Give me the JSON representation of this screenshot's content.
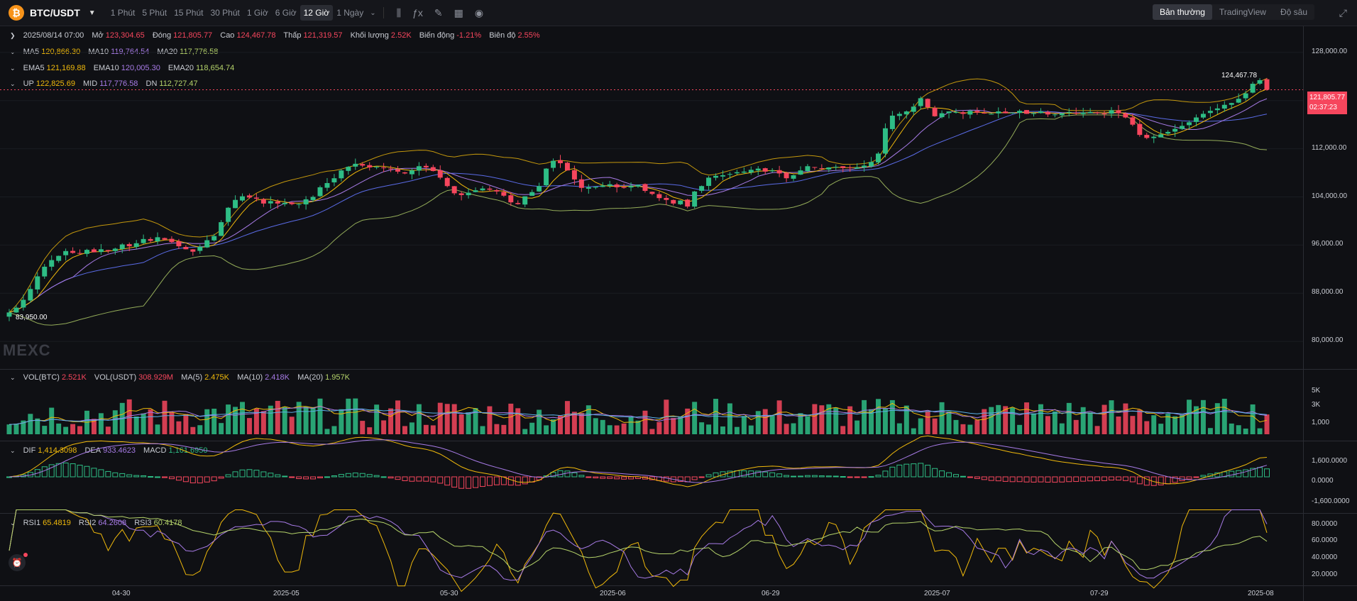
{
  "toolbar": {
    "pair": "BTC/USDT",
    "timeframes": [
      "1 Phút",
      "5 Phút",
      "15 Phút",
      "30 Phút",
      "1 Giờ",
      "6 Giờ",
      "12 Giờ",
      "1 Ngày"
    ],
    "active_timeframe": "12 Giờ",
    "view_tabs": [
      "Bản thường",
      "TradingView",
      "Độ sâu"
    ],
    "active_view": "Bản thường"
  },
  "ohlc": {
    "date": "2025/08/14 07:00",
    "open_label": "Mở",
    "open": "123,304.65",
    "close_label": "Đóng",
    "close": "121,805.77",
    "high_label": "Cao",
    "high": "124,467.78",
    "low_label": "Thấp",
    "low": "121,319.57",
    "volume_label": "Khối lượng",
    "volume": "2.52K",
    "change_label": "Biến động",
    "change": "-1.21%",
    "amplitude_label": "Biên độ",
    "amplitude": "2.55%"
  },
  "ma": {
    "ma5_label": "MA5",
    "ma5": "120,866.30",
    "ma10_label": "MA10",
    "ma10": "119,764.54",
    "ma20_label": "MA20",
    "ma20": "117,776.58"
  },
  "ema": {
    "ema5_label": "EMA5",
    "ema5": "121,169.88",
    "ema10_label": "EMA10",
    "ema10": "120,005.30",
    "ema20_label": "EMA20",
    "ema20": "118,654.74"
  },
  "boll": {
    "up_label": "UP",
    "up": "122,825.69",
    "mid_label": "MID",
    "mid": "117,776.58",
    "dn_label": "DN",
    "dn": "112,727.47"
  },
  "vol": {
    "btc_label": "VOL(BTC)",
    "btc": "2.521K",
    "usdt_label": "VOL(USDT)",
    "usdt": "308.929M",
    "ma5_label": "MA(5)",
    "ma5": "2.475K",
    "ma10_label": "MA(10)",
    "ma10": "2.418K",
    "ma20_label": "MA(20)",
    "ma20": "1.957K"
  },
  "macd": {
    "dif_label": "DIF",
    "dif": "1,414.3098",
    "dea_label": "DEA",
    "dea": "933.4623",
    "macd_label": "MACD",
    "macd": "1,161.6950"
  },
  "rsi": {
    "rsi1_label": "RSI1",
    "rsi1": "65.4819",
    "rsi2_label": "RSI2",
    "rsi2": "64.2608",
    "rsi3_label": "RSI3",
    "rsi3": "60.4178"
  },
  "price_axis": [
    "128,000.00",
    "120,000.00",
    "112,000.00",
    "104,000.00",
    "96,000.00",
    "88,000.00",
    "80,000.00"
  ],
  "vol_axis": [
    "5K",
    "3K",
    "1,000"
  ],
  "macd_axis": [
    "1,600.0000",
    "0.0000",
    "-1,600.0000"
  ],
  "rsi_axis": [
    "80.0000",
    "60.0000",
    "40.0000",
    "20.0000"
  ],
  "x_axis": [
    "04-30",
    "2025-05",
    "05-30",
    "2025-06",
    "06-29",
    "2025-07",
    "07-29",
    "2025-08"
  ],
  "last_price": "121,805.77",
  "countdown": "02:37:23",
  "high_marker": "124,467.78",
  "low_marker": "83,950.00",
  "watermark": "MEXC",
  "colors": {
    "up": "#2ebd85",
    "down": "#f6465d",
    "ma5": "#f0b90b",
    "ma10": "#a77be6",
    "ma20": "#b5d36a"
  },
  "chart_data": {
    "type": "candlestick",
    "price_range": [
      76000,
      132000
    ],
    "closes": [
      84800,
      85600,
      86900,
      88700,
      90800,
      92400,
      93500,
      94200,
      95000,
      94700,
      94600,
      95200,
      94800,
      95300,
      95000,
      95400,
      96100,
      95800,
      96300,
      97000,
      96700,
      97300,
      96900,
      96500,
      95800,
      95300,
      94900,
      95700,
      96800,
      97500,
      99800,
      102200,
      103500,
      104100,
      103900,
      103700,
      102900,
      103300,
      102900,
      103000,
      102800,
      102800,
      103600,
      104000,
      105600,
      106300,
      107100,
      108400,
      109000,
      109500,
      109200,
      108900,
      109000,
      108800,
      108600,
      108200,
      107900,
      108400,
      109100,
      108900,
      108300,
      107200,
      105800,
      104600,
      104300,
      104700,
      105100,
      105400,
      105200,
      104900,
      104200,
      103100,
      102800,
      104100,
      104800,
      105800,
      108700,
      110000,
      109600,
      108400,
      106900,
      105500,
      105600,
      105700,
      105900,
      106100,
      105600,
      105500,
      105800,
      106000,
      105000,
      104500,
      103800,
      103500,
      102900,
      103400,
      102400,
      104900,
      105800,
      107200,
      107500,
      107600,
      107800,
      108100,
      108200,
      108500,
      108700,
      108200,
      108400,
      107900,
      107100,
      107600,
      108400,
      109100,
      108900,
      108700,
      108900,
      109000,
      108800,
      108800,
      108900,
      109200,
      109800,
      111200,
      115400,
      117500,
      117800,
      118200,
      119000,
      120400,
      118900,
      117400,
      117900,
      118200,
      118100,
      117800,
      118300,
      118000,
      117900,
      117800,
      118200,
      117900,
      118000,
      118300,
      117800,
      117900,
      118200,
      117700,
      117700,
      117900,
      118100,
      117900,
      118000,
      118100,
      118000,
      117800,
      118400,
      117900,
      117200,
      116000,
      114300,
      113800,
      114000,
      114400,
      114800,
      115300,
      115800,
      116400,
      117200,
      117800,
      118300,
      118700,
      119300,
      119600,
      120300,
      121200,
      122800,
      123400,
      121800
    ],
    "highs_note": "visual approximation",
    "rsi_range": [
      10,
      90
    ],
    "macd_range": [
      -2400,
      2400
    ]
  }
}
